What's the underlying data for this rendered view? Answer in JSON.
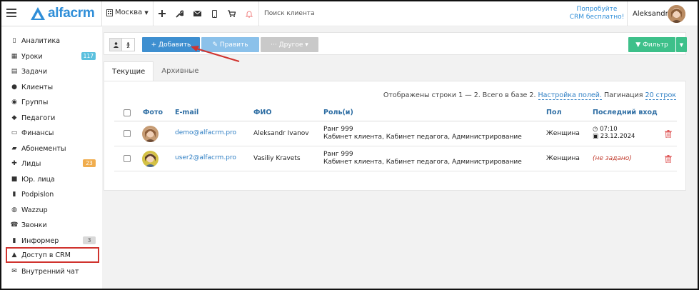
{
  "app": {
    "logo_text": "alfacrm",
    "branch": "Москва",
    "search_placeholder": "Поиск клиента",
    "promo_line1": "Попробуйте",
    "promo_line2": "CRM бесплатно!",
    "user_name": "Aleksandr"
  },
  "sidebar": {
    "items": [
      {
        "label": "Аналитика",
        "icon": "book-icon"
      },
      {
        "label": "Уроки",
        "icon": "calendar-icon",
        "badge": "117",
        "badge_color": "#5bc0de"
      },
      {
        "label": "Задачи",
        "icon": "clipboard-icon"
      },
      {
        "label": "Клиенты",
        "icon": "user-icon"
      },
      {
        "label": "Группы",
        "icon": "group-icon"
      },
      {
        "label": "Педагоги",
        "icon": "graduation-cap-icon"
      },
      {
        "label": "Финансы",
        "icon": "money-icon"
      },
      {
        "label": "Абонементы",
        "icon": "ticket-icon"
      },
      {
        "label": "Лиды",
        "icon": "add-user-icon",
        "badge": "23",
        "badge_color": "#f0ad4e"
      },
      {
        "label": "Юр. лица",
        "icon": "briefcase-icon"
      },
      {
        "label": "Podpislon",
        "icon": "document-icon"
      },
      {
        "label": "Wazzup",
        "icon": "whatsapp-icon"
      },
      {
        "label": "Звонки",
        "icon": "phone-icon"
      },
      {
        "label": "Информер",
        "icon": "document-icon",
        "badge": "3",
        "badge_color": "#d9d9d9"
      },
      {
        "label": "Доступ в CRM",
        "icon": "lock-icon",
        "active": true
      },
      {
        "label": "Внутренний чат",
        "icon": "envelope-icon"
      }
    ]
  },
  "toolbar": {
    "add_label": "+ Добавить",
    "edit_label": "✎ Править",
    "other_label": "··· Другое ▾",
    "filter_label": "▼ Фильтр"
  },
  "tabs": {
    "current": "Текущие",
    "archive": "Архивные"
  },
  "panel": {
    "info_text": "Отображены строки 1 — 2. Всего в базе 2.",
    "settings_link": "Настройка полей.",
    "pagination_label": "Пагинация",
    "pagination_value": "20 строк"
  },
  "table": {
    "headers": [
      "Фото",
      "E-mail",
      "ФИО",
      "Роль(и)",
      "Пол",
      "Последний вход"
    ],
    "rows": [
      {
        "email": "demo@alfacrm.pro",
        "name": "Aleksandr Ivanov",
        "rank": "Ранг 999",
        "roles": "Кабинет клиента, Кабинет педагога, Администрирование",
        "gender": "Женщина",
        "login_time": "07:10",
        "login_date": "23.12.2024"
      },
      {
        "email": "user2@alfacrm.pro",
        "name": "Vasiliy Kravets",
        "rank": "Ранг 999",
        "roles": "Кабинет клиента, Кабинет педагога, Администрирование",
        "gender": "Женщина",
        "login_empty": "(не задано)"
      }
    ]
  },
  "colors": {
    "brand": "#2f8ed8",
    "add_button": "#3e8fd0",
    "filter_button": "#3ec08a",
    "highlight": "#d0332e"
  }
}
